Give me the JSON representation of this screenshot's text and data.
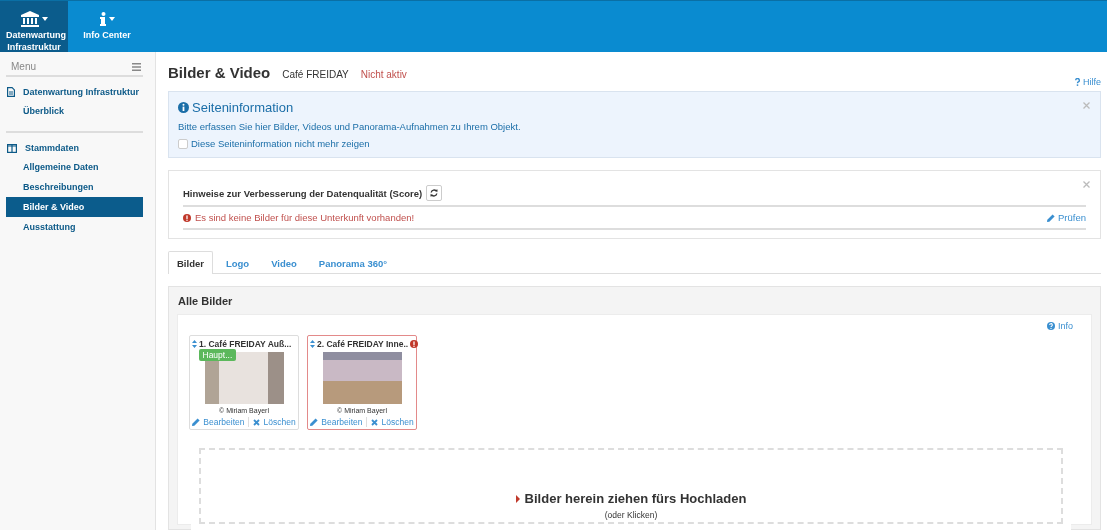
{
  "top_nav": [
    {
      "kind": "bank",
      "label": "Datenwartung Infrastruktur",
      "selected": true
    },
    {
      "kind": "info",
      "label": "Info Center",
      "selected": false
    }
  ],
  "sidebar": {
    "menu_label": "Menu",
    "sections": [
      {
        "kind": "document",
        "title": "Datenwartung Infrastruktur",
        "items": [
          {
            "label": "Überblick",
            "selected": false
          }
        ]
      },
      {
        "kind": "columns",
        "title": "Stammdaten",
        "items": [
          {
            "label": "Allgemeine Daten",
            "selected": false
          },
          {
            "label": "Beschreibungen",
            "selected": false
          },
          {
            "label": "Bilder & Video",
            "selected": true
          },
          {
            "label": "Ausstattung",
            "selected": false
          }
        ]
      }
    ]
  },
  "page": {
    "title": "Bilder & Video",
    "object_name": "Café FREIDAY",
    "status": "Nicht aktiv",
    "help": "Hilfe"
  },
  "info_box": {
    "title": "Seiteninformation",
    "text": "Bitte erfassen Sie hier Bilder, Videos und Panorama-Aufnahmen zu Ihrem Objekt.",
    "checkbox": {
      "label": "Diese Seiteninformation nicht mehr zeigen",
      "checked": false
    }
  },
  "score_box": {
    "title": "Hinweise zur Verbesserung der Datenqualität (Score)",
    "warnings": [
      {
        "text": "Es sind keine Bilder für diese Unterkunft vorhanden!",
        "action": "Prüfen"
      }
    ]
  },
  "tabs": [
    {
      "label": "Bilder",
      "selected": true
    },
    {
      "label": "Logo",
      "selected": false
    },
    {
      "label": "Video",
      "selected": false
    },
    {
      "label": "Panorama 360°",
      "selected": false
    }
  ],
  "gallery": {
    "title": "Alle Bilder",
    "info": "Info",
    "images": [
      {
        "title": "1. Café FREIDAY Auß...",
        "badge": "Haupt...",
        "credit": "© Miriam Bayerl",
        "has_error": false,
        "edit": "Bearbeiten",
        "delete": "Löschen"
      },
      {
        "title": "2. Café FREIDAY Inne..",
        "credit": "© Miriam Bayerl",
        "has_error": true,
        "edit": "Bearbeiten",
        "delete": "Löschen"
      }
    ]
  },
  "dropzone": {
    "text": "Bilder herein ziehen fürs Hochladen",
    "hint": "(oder Klicken)"
  }
}
